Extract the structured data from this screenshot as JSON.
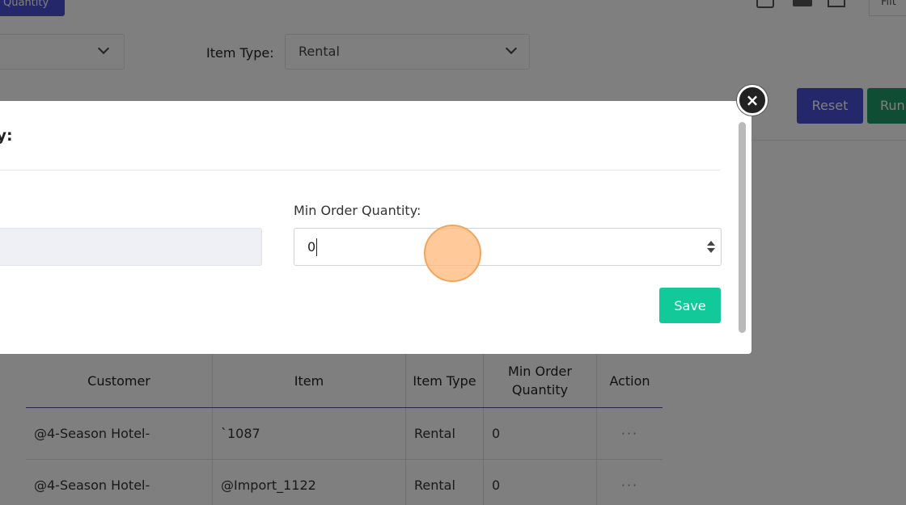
{
  "background": {
    "top_tab_label": "Quantity",
    "top_right_button_label": "Filt",
    "filters": {
      "left_select_value": "",
      "item_type_label": "Item Type:",
      "item_type_value": "Rental"
    },
    "buttons": {
      "reset_label": "Reset",
      "run_label": "Run"
    },
    "table": {
      "headers": [
        "Customer",
        "Item",
        "Item Type",
        "Min Order Quantity",
        "Action"
      ],
      "rows": [
        {
          "customer": "@4-Season Hotel-",
          "item": "`1087",
          "item_type": "Rental",
          "min_qty": "0",
          "action": "···"
        },
        {
          "customer": "@4-Season Hotel-",
          "item": "@Import_1122",
          "item_type": "Rental",
          "min_qty": "0",
          "action": "···"
        }
      ]
    }
  },
  "modal": {
    "title": "ity:",
    "left_field_value": "",
    "min_order_label": "Min Order Quantity:",
    "min_order_value": "0",
    "save_label": "Save",
    "close_symbol": "×"
  }
}
